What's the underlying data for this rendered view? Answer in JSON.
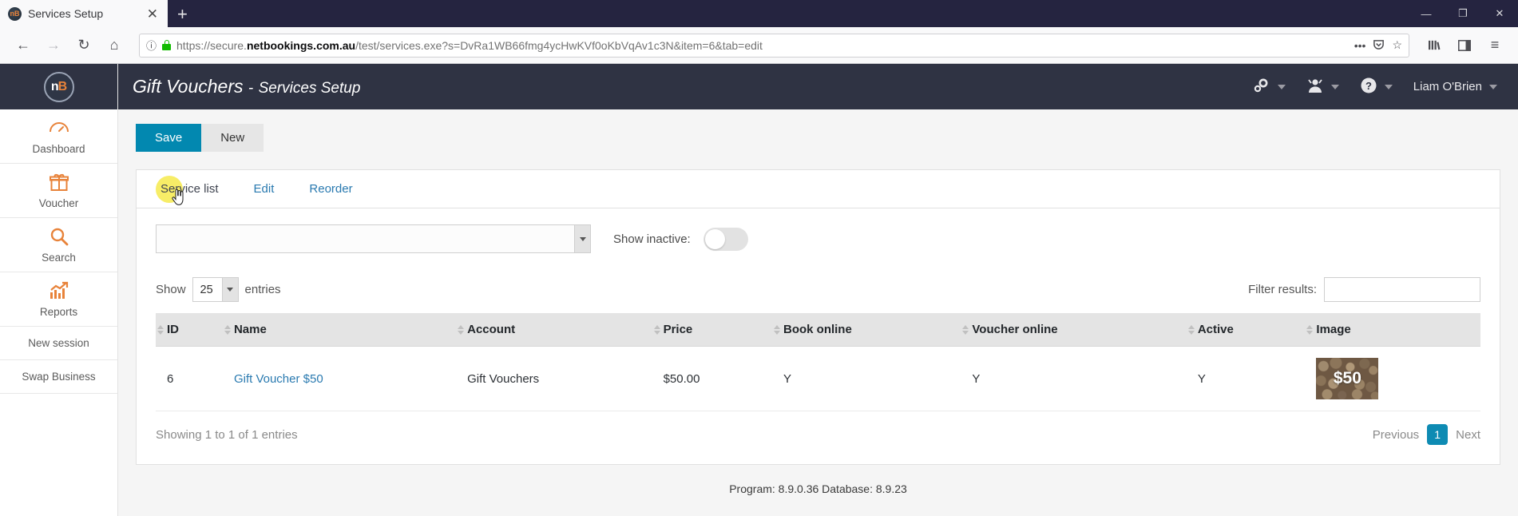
{
  "browser": {
    "tab": {
      "title": "Services Setup",
      "favicon": "nb-logo-icon",
      "close": "✕"
    },
    "newtab_label": "+",
    "window_controls": {
      "minimize": "—",
      "maximize": "❐",
      "close": "✕"
    },
    "nav": {
      "back": "←",
      "forward": "→",
      "reload": "↻",
      "home": "⌂"
    },
    "url": {
      "scheme": "https://secure.",
      "host": "netbookings.com.au",
      "path": "/test/services.exe?s=DvRa1WB66fmg4ycHwKVf0oKbVqAv1c3N&item=6&tab=edit",
      "full": "https://secure.netbookings.com.au/test/services.exe?s=DvRa1WB66fmg4ycHwKVf0oKbVqAv1c3N&item=6&tab=edit",
      "info_icon": "ⓘ",
      "lock_icon": "padlock-icon"
    },
    "url_actions": {
      "ellipsis": "•••",
      "pocket": "▼",
      "bookmark": "☆"
    },
    "toolbar_right": {
      "library": "library-icon",
      "sidebars": "sidebar-icon",
      "menu": "≡"
    }
  },
  "sidebar": {
    "logo": {
      "n": "n",
      "b": "B"
    },
    "items": [
      {
        "label": "Dashboard",
        "icon": "gauge-icon"
      },
      {
        "label": "Voucher",
        "icon": "gift-icon"
      },
      {
        "label": "Search",
        "icon": "magnifier-icon"
      },
      {
        "label": "Reports",
        "icon": "chart-icon"
      },
      {
        "label": "New session",
        "icon": ""
      },
      {
        "label": "Swap Business",
        "icon": ""
      }
    ]
  },
  "topbar": {
    "title_main": "Gift Vouchers",
    "title_dash": "-",
    "title_sub": "Services Setup",
    "settings_icon": "gears-icon",
    "user_icon": "person-icon",
    "help_icon": "question-circle-icon",
    "username": "Liam O'Brien"
  },
  "toolbar": {
    "save_label": "Save",
    "new_label": "New"
  },
  "tabs": [
    {
      "label": "Service list",
      "active": true
    },
    {
      "label": "Edit",
      "active": false
    },
    {
      "label": "Reorder",
      "active": false
    }
  ],
  "filters": {
    "account_select_value": "",
    "show_inactive_label": "Show inactive:",
    "show_inactive_on": false,
    "show_label": "Show",
    "entries_value": "25",
    "entries_label": "entries",
    "filter_label": "Filter results:",
    "filter_value": "",
    "filter_placeholder": ""
  },
  "table": {
    "columns": [
      "ID",
      "Name",
      "Account",
      "Price",
      "Book online",
      "Voucher online",
      "Active",
      "Image"
    ],
    "rows": [
      {
        "id": "6",
        "name": "Gift Voucher $50",
        "account": "Gift Vouchers",
        "price": "$50.00",
        "book_online": "Y",
        "voucher_online": "Y",
        "active": "Y",
        "image_label": "$50"
      }
    ],
    "showing_text": "Showing 1 to 1 of 1 entries",
    "pagination": {
      "previous": "Previous",
      "pages": [
        "1"
      ],
      "current": "1",
      "next": "Next"
    }
  },
  "footer": {
    "text": "Program: 8.9.0.36 Database: 8.9.23"
  },
  "colors": {
    "accent_blue": "#0288b0",
    "sidebar_icon_orange": "#e8833a",
    "header_dark": "#2f3343",
    "link_blue": "#2a7ab0",
    "highlight_yellow": "#f6ea4c"
  }
}
